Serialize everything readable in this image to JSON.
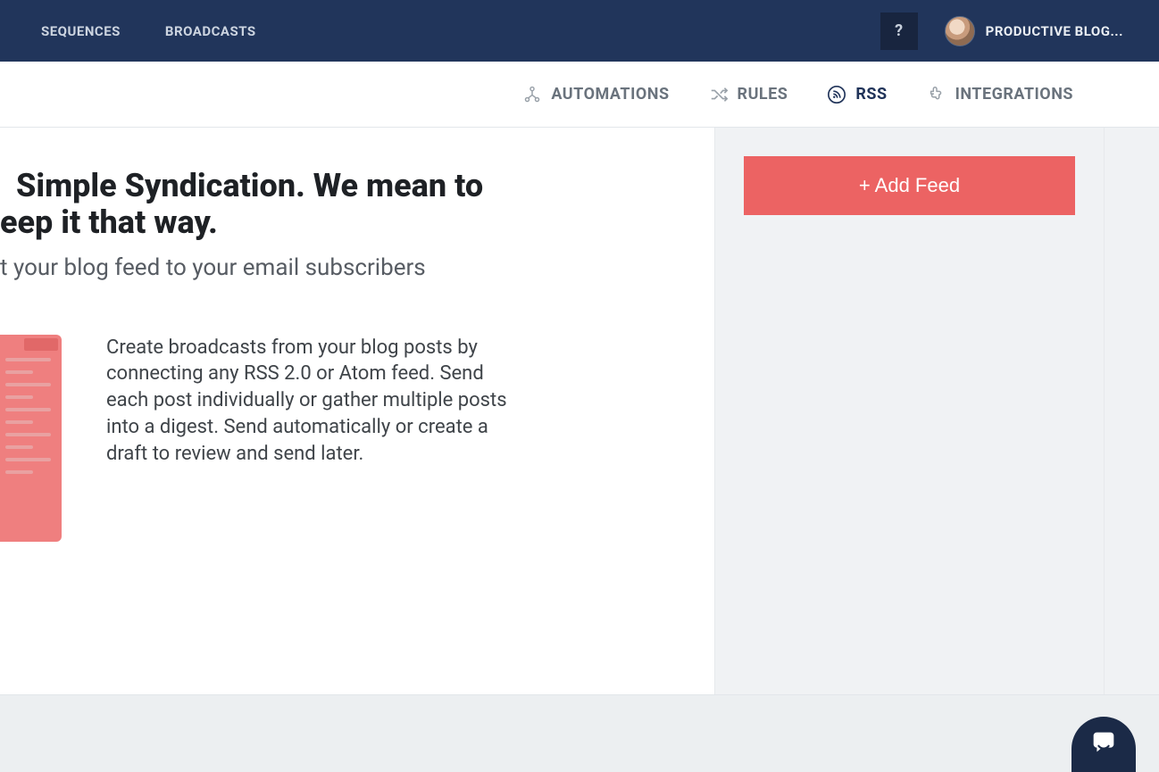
{
  "topnav": {
    "sequences": "SEQUENCES",
    "broadcasts": "BROADCASTS"
  },
  "help_label": "?",
  "account": {
    "name": "PRODUCTIVE BLOG..."
  },
  "subnav": {
    "automations": "AUTOMATIONS",
    "rules": "RULES",
    "rss": "RSS",
    "integrations": "INTEGRATIONS"
  },
  "page": {
    "headline_line1": "Simple Syndication. We mean to",
    "headline_line2": "eep it that way.",
    "subhead": "t your blog feed to your email subscribers",
    "description": "Create broadcasts from your blog posts by connecting any RSS 2.0 or Atom feed. Send each post individually or gather multiple posts into a digest. Send automatically or create a draft to review and send later."
  },
  "sidebar": {
    "add_feed": "+ Add Feed"
  }
}
